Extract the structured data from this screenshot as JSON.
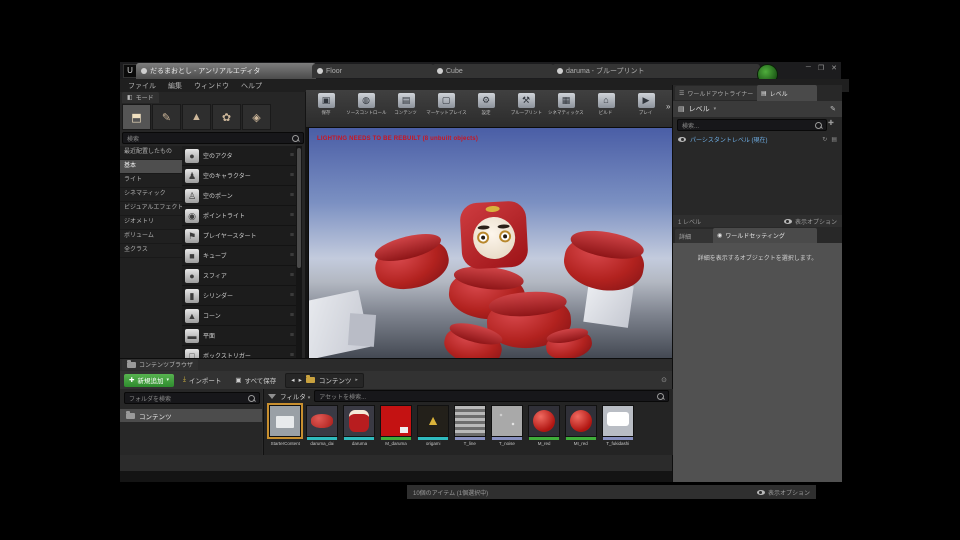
{
  "colors": {
    "accent_green": "#2e8b2e",
    "selection_blue": "#6fb0e8",
    "warning_red": "#cc1420",
    "bar_staticmesh": "#2fbabd",
    "bar_material": "#3fae3a",
    "bar_texture": "#8890c0"
  },
  "window": {
    "tabs": [
      {
        "label": "だるまおとし - アンリアルエディタ",
        "active": true
      },
      {
        "label": "Floor",
        "active": false
      },
      {
        "label": "Cube",
        "active": false
      },
      {
        "label": "daruma - ブループリント",
        "active": false
      }
    ],
    "logo": "U",
    "controls": {
      "minimize": "─",
      "maximize": "❐",
      "close": "✕"
    }
  },
  "menubar": {
    "items": [
      {
        "label": "ファイル"
      },
      {
        "label": "編集"
      },
      {
        "label": "ウィンドウ"
      },
      {
        "label": "ヘルプ"
      }
    ]
  },
  "modes": {
    "tab_label": "モード",
    "tools": [
      {
        "name": "place-mode",
        "glyph": "⬒",
        "active": true
      },
      {
        "name": "paint-mode",
        "glyph": "✎",
        "active": false
      },
      {
        "name": "landscape-mode",
        "glyph": "▲",
        "active": false
      },
      {
        "name": "foliage-mode",
        "glyph": "✿",
        "active": false
      },
      {
        "name": "geometry-mode",
        "glyph": "◈",
        "active": false
      }
    ],
    "search_placeholder": "検索",
    "categories": [
      {
        "label": "最近配置したもの",
        "selected": false
      },
      {
        "label": "基本",
        "selected": true
      },
      {
        "label": "ライト",
        "selected": false
      },
      {
        "label": "シネマティック",
        "selected": false
      },
      {
        "label": "ビジュアルエフェクト",
        "selected": false
      },
      {
        "label": "ジオメトリ",
        "selected": false
      },
      {
        "label": "ボリューム",
        "selected": false
      },
      {
        "label": "全クラス",
        "selected": false
      }
    ],
    "items": [
      {
        "label": "空のアクタ",
        "icon": "empty-actor-icon",
        "glyph": "●"
      },
      {
        "label": "空のキャラクター",
        "icon": "empty-character-icon",
        "glyph": "♟"
      },
      {
        "label": "空のポーン",
        "icon": "empty-pawn-icon",
        "glyph": "♙"
      },
      {
        "label": "ポイントライト",
        "icon": "point-light-icon",
        "glyph": "◉"
      },
      {
        "label": "プレイヤースタート",
        "icon": "player-start-icon",
        "glyph": "⚑"
      },
      {
        "label": "キューブ",
        "icon": "cube-icon",
        "glyph": "■"
      },
      {
        "label": "スフィア",
        "icon": "sphere-icon",
        "glyph": "●"
      },
      {
        "label": "シリンダー",
        "icon": "cylinder-icon",
        "glyph": "▮"
      },
      {
        "label": "コーン",
        "icon": "cone-icon",
        "glyph": "▲"
      },
      {
        "label": "平面",
        "icon": "plane-icon",
        "glyph": "▬"
      },
      {
        "label": "ボックストリガー",
        "icon": "box-trigger-icon",
        "glyph": "□"
      }
    ],
    "grip": "≡"
  },
  "toolbar": {
    "items": [
      {
        "label": "保存",
        "icon": "save-icon",
        "glyph": "▣"
      },
      {
        "label": "ソースコントロール",
        "icon": "source-control-icon",
        "glyph": "◍"
      },
      {
        "label": "コンテンツ",
        "icon": "content-icon",
        "glyph": "▤"
      },
      {
        "label": "マーケットプレイス",
        "icon": "marketplace-icon",
        "glyph": "▢"
      },
      {
        "label": "設定",
        "icon": "settings-icon",
        "glyph": "⚙"
      },
      {
        "label": "ブループリント",
        "icon": "blueprints-icon",
        "glyph": "⚒"
      },
      {
        "label": "シネマティックス",
        "icon": "cinematics-icon",
        "glyph": "▦"
      },
      {
        "label": "ビルド",
        "icon": "build-icon",
        "glyph": "⌂"
      },
      {
        "label": "プレイ",
        "icon": "play-icon",
        "glyph": "▶"
      }
    ],
    "overflow": "»"
  },
  "viewport": {
    "warning": "LIGHTING NEEDS TO BE REBUILT (8 unbuilt objects)"
  },
  "levels_panel": {
    "tabs": [
      {
        "label": "ワールドアウトライナー",
        "active": false
      },
      {
        "label": "レベル",
        "active": true
      }
    ],
    "header_label": "レベル",
    "header_caret": "▾",
    "edit_icon": "✎",
    "search_placeholder": "検索...",
    "add_icon": "✚",
    "level_row": {
      "label": "パーシスタントレベル (現在)",
      "icon_a": "↻",
      "icon_b": "▤"
    },
    "footer_left": "1 レベル",
    "footer_right": "表示オプション"
  },
  "details_panel": {
    "tabs": [
      {
        "label": "詳細",
        "active": false
      },
      {
        "label": "ワールドセッティング",
        "active": true
      }
    ],
    "hint": "詳細を表示するオブジェクトを選択します。"
  },
  "content_browser": {
    "tab_label": "コンテンツブラウザ",
    "add_new": "新規追加",
    "add_new_glyph": "✚",
    "import": "インポート",
    "import_glyph": "⤓",
    "save_all": "すべて保存",
    "save_all_glyph": "▣",
    "nav_back": "◂",
    "nav_fwd": "▸",
    "breadcrumb": "コンテンツ",
    "breadcrumb_caret": "▸",
    "lock_glyph": "⊙",
    "folder_search_placeholder": "フォルダを検索",
    "source_row": "コンテンツ",
    "filter_label": "フィルタ",
    "filter_caret": "▾",
    "asset_search_placeholder": "アセットを検索...",
    "tiles": [
      {
        "name": "StarterContent",
        "thumb": "th-folder",
        "bar": "#00000000",
        "selected": true
      },
      {
        "name": "daruma_dai",
        "thumb": "th-cyl",
        "bar": "#2fbabd",
        "selected": false
      },
      {
        "name": "daruma",
        "thumb": "th-daruma",
        "bar": "#2fbabd",
        "selected": false
      },
      {
        "name": "M_daruma",
        "thumb": "th-redflat",
        "bar": "#3fae3a",
        "selected": false
      },
      {
        "name": "origami",
        "thumb": "th-origami",
        "bar": "#2fbabd",
        "selected": false,
        "glyph": "▲"
      },
      {
        "name": "T_line",
        "thumb": "th-lines",
        "bar": "#8890c0",
        "selected": false
      },
      {
        "name": "T_noise",
        "thumb": "th-noise",
        "bar": "#8890c0",
        "selected": false
      },
      {
        "name": "M_red",
        "thumb": "th-ball",
        "bar": "#3fae3a",
        "selected": false
      },
      {
        "name": "MI_red",
        "thumb": "th-ball",
        "bar": "#3fae3a",
        "selected": false
      },
      {
        "name": "T_fukidashi",
        "thumb": "th-bubble",
        "bar": "#8890c0",
        "selected": false
      }
    ],
    "footer_left": "10個のアイテム (1個選択中)",
    "footer_right": "表示オプション"
  }
}
